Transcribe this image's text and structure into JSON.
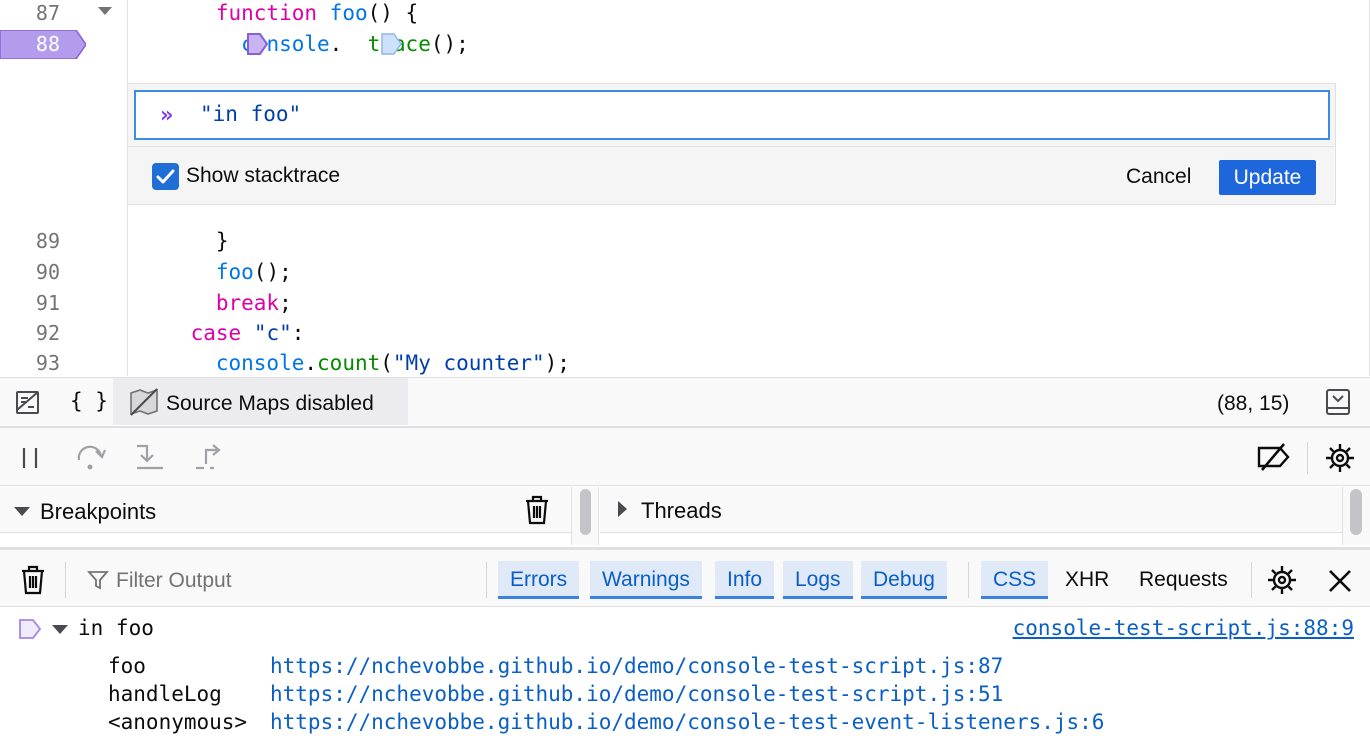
{
  "editor": {
    "line_numbers": [
      "87",
      "88",
      "89",
      "90",
      "91",
      "92",
      "93"
    ],
    "breakpoint_line": "88",
    "lines": {
      "l87": {
        "kw": "function",
        "name": "foo",
        "rest": "() {"
      },
      "l88": {
        "obj": "console",
        "dot": ".",
        "meth": "trace",
        "rest": "();"
      },
      "l89": {
        "text": "}"
      },
      "l90": {
        "name": "foo",
        "rest": "();"
      },
      "l91": {
        "kw": "break",
        "rest": ";"
      },
      "l92": {
        "kw": "case",
        "str": "\"c\"",
        "rest": ":"
      },
      "l93": {
        "obj": "console",
        "dot": ".",
        "meth": "count",
        "open": "(",
        "str": "\"My counter\"",
        "rest": ");"
      }
    }
  },
  "logpoint": {
    "prompt": "»",
    "value": "\"in foo\"",
    "show_stacktrace_label": "Show stacktrace",
    "show_stacktrace_checked": true,
    "cancel_label": "Cancel",
    "update_label": "Update"
  },
  "editor_footer": {
    "braces_label": "{ }",
    "source_maps_label": "Source Maps disabled",
    "cursor_position": "(88, 15)"
  },
  "debugger": {
    "breakpoints_label": "Breakpoints",
    "threads_label": "Threads"
  },
  "console": {
    "filter_placeholder": "Filter Output",
    "filters": [
      {
        "label": "Errors",
        "on": true
      },
      {
        "label": "Warnings",
        "on": true
      },
      {
        "label": "Info",
        "on": true
      },
      {
        "label": "Logs",
        "on": true
      },
      {
        "label": "Debug",
        "on": true
      },
      {
        "label": "CSS",
        "on": true
      },
      {
        "label": "XHR",
        "on": false
      },
      {
        "label": "Requests",
        "on": false
      }
    ],
    "message": {
      "text": "in foo",
      "location": "console-test-script.js:88:9",
      "stack": [
        {
          "fn": "foo",
          "url": "https://nchevobbe.github.io/demo/console-test-script.js:87"
        },
        {
          "fn": "handleLog",
          "url": "https://nchevobbe.github.io/demo/console-test-script.js:51"
        },
        {
          "fn": "<anonymous>",
          "url": "https://nchevobbe.github.io/demo/console-test-event-listeners.js:6"
        }
      ]
    }
  },
  "colors": {
    "logpoint": "#a585e6",
    "accent": "#1e66dc",
    "link": "#0a5fc6"
  }
}
